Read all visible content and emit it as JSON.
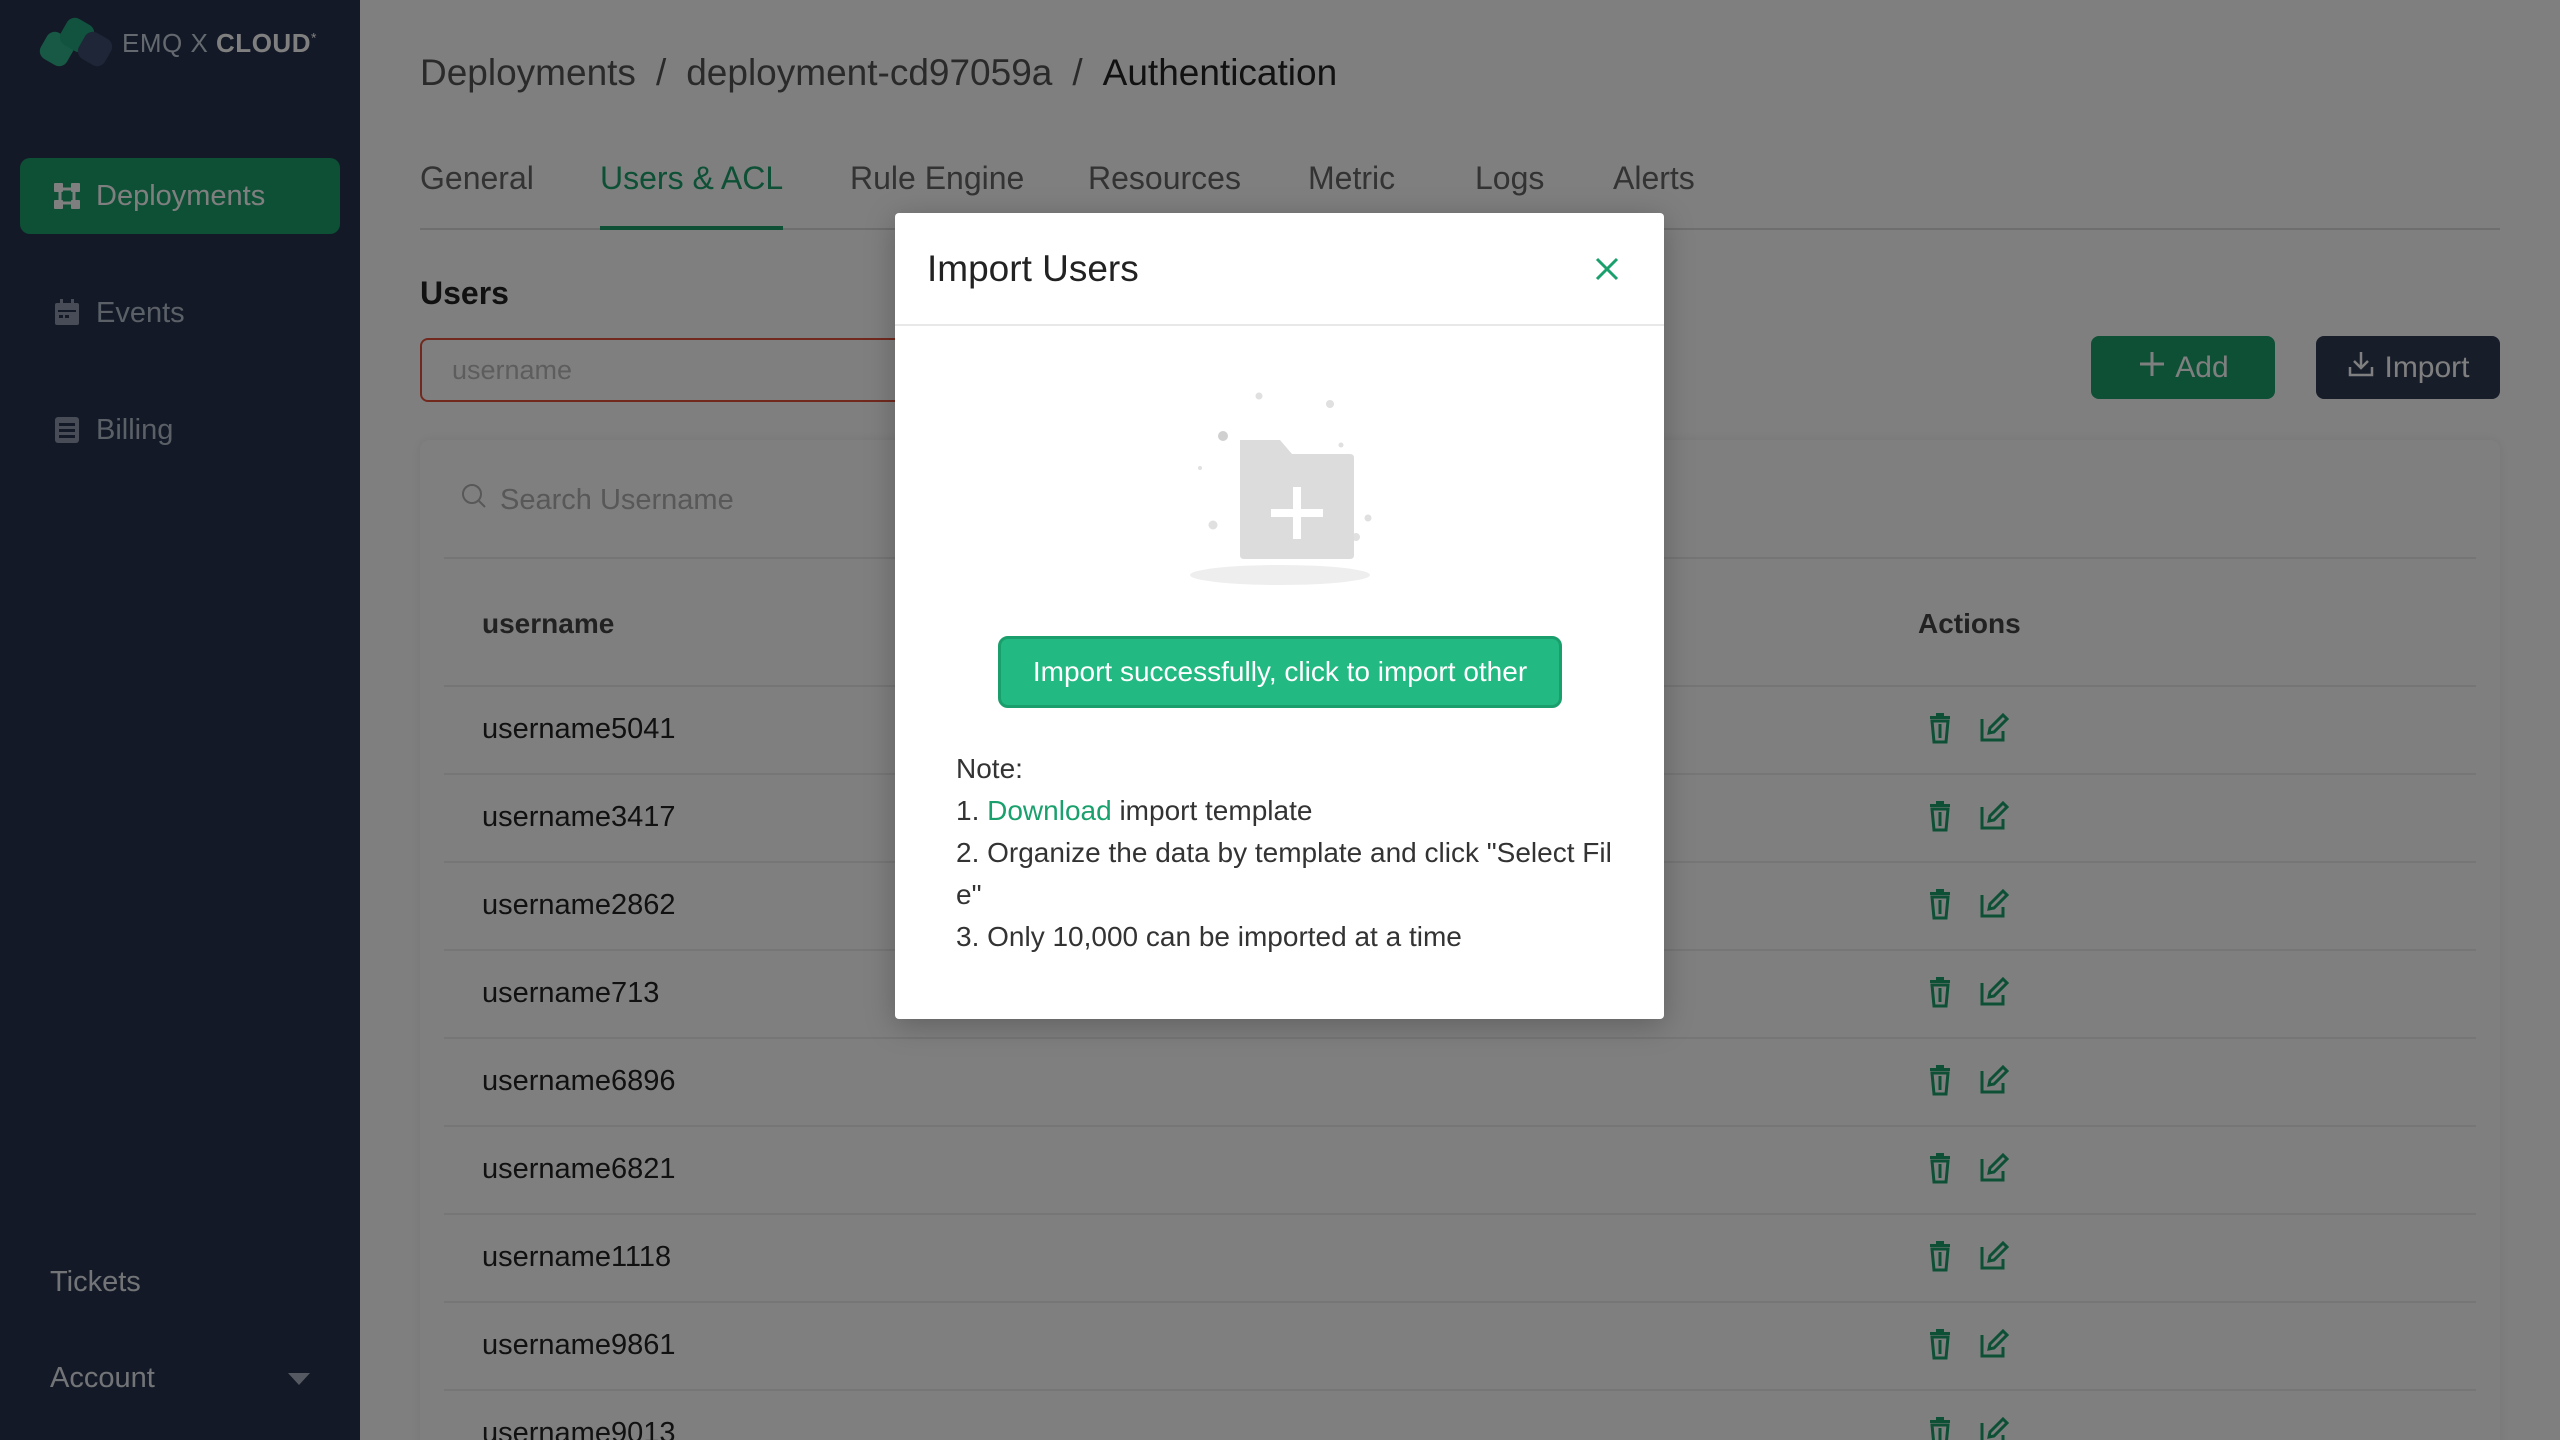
{
  "sidebar": {
    "logo_prefix": "EMQ X",
    "logo_brand": "CLOUD",
    "logo_sup": "*",
    "items": [
      {
        "label": "Deployments",
        "icon": "deployments-icon",
        "active": true
      },
      {
        "label": "Events",
        "icon": "calendar-icon",
        "active": false
      },
      {
        "label": "Billing",
        "icon": "billing-icon",
        "active": false
      }
    ],
    "tickets_label": "Tickets",
    "account_label": "Account"
  },
  "breadcrumb": {
    "part1": "Deployments",
    "sep": "/",
    "part2": "deployment-cd97059a",
    "current": "Authentication"
  },
  "tabs": [
    {
      "label": "General",
      "active": false
    },
    {
      "label": "Users & ACL",
      "active": true
    },
    {
      "label": "Rule Engine",
      "active": false
    },
    {
      "label": "Resources",
      "active": false
    },
    {
      "label": "Metric",
      "active": false
    },
    {
      "label": "Logs",
      "active": false
    },
    {
      "label": "Alerts",
      "active": false
    }
  ],
  "users": {
    "title": "Users",
    "username_placeholder": "username",
    "add_label": "Add",
    "import_label": "Import",
    "search_placeholder": "Search Username",
    "col_username": "username",
    "col_actions": "Actions",
    "rows": [
      "username5041",
      "username3417",
      "username2862",
      "username713",
      "username6896",
      "username6821",
      "username1118",
      "username9861",
      "username9013"
    ]
  },
  "modal": {
    "title": "Import Users",
    "import_button": "Import successfully, click to import other",
    "note_title": "Note:",
    "note1_prefix": "1. ",
    "note1_link": "Download",
    "note1_suffix": " import template",
    "note2_line1": "2. Organize the data by template and click \"Select Fil",
    "note2_line2": "e\"",
    "note3": "3. Only 10,000 can be imported at a time"
  },
  "colors": {
    "accent": "#1aa06d",
    "sidebar_bg": "#26334d",
    "import_btn": "#313b55",
    "danger_border": "#e2533d",
    "modal_button": "#23b983"
  }
}
